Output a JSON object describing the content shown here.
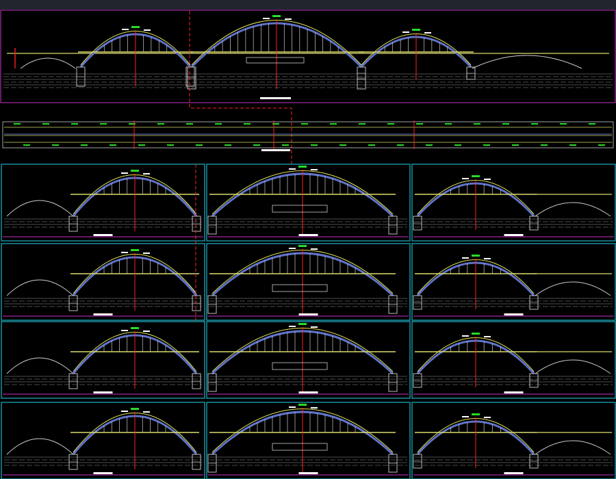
{
  "colors": {
    "background": "#000000",
    "topbar": "#22252e",
    "magenta_frame": "#c832c8",
    "cyan_frame": "#1fb5c8",
    "arch": "#5e72c8",
    "arch_upper": "#e6e655",
    "deck": "#dcdc6e",
    "hangers": "#cfcfcf",
    "pier": "#bdbdbd",
    "centerline": "#ff2020",
    "ground": "#9a9a9a",
    "labels": "#ffffff",
    "annotation_green": "#28dc28"
  },
  "drawing": {
    "elevation_view": {
      "components": [
        "left-arch-span",
        "main-arch-span",
        "right-arch-span",
        "left-approach",
        "right-approach"
      ]
    },
    "plan_view": {
      "components": [
        "deck-plan-strip"
      ]
    },
    "detail_grid": {
      "rows": 4,
      "columns": 3,
      "cells": [
        {
          "row": 1,
          "col": 1,
          "variant": "left-span"
        },
        {
          "row": 1,
          "col": 2,
          "variant": "main-span"
        },
        {
          "row": 1,
          "col": 3,
          "variant": "right-span"
        },
        {
          "row": 2,
          "col": 1,
          "variant": "left-span"
        },
        {
          "row": 2,
          "col": 2,
          "variant": "main-span"
        },
        {
          "row": 2,
          "col": 3,
          "variant": "right-span"
        },
        {
          "row": 3,
          "col": 1,
          "variant": "left-span"
        },
        {
          "row": 3,
          "col": 2,
          "variant": "main-span"
        },
        {
          "row": 3,
          "col": 3,
          "variant": "right-span"
        },
        {
          "row": 4,
          "col": 1,
          "variant": "left-span"
        },
        {
          "row": 4,
          "col": 2,
          "variant": "main-span"
        },
        {
          "row": 4,
          "col": 3,
          "variant": "right-span"
        }
      ]
    }
  }
}
